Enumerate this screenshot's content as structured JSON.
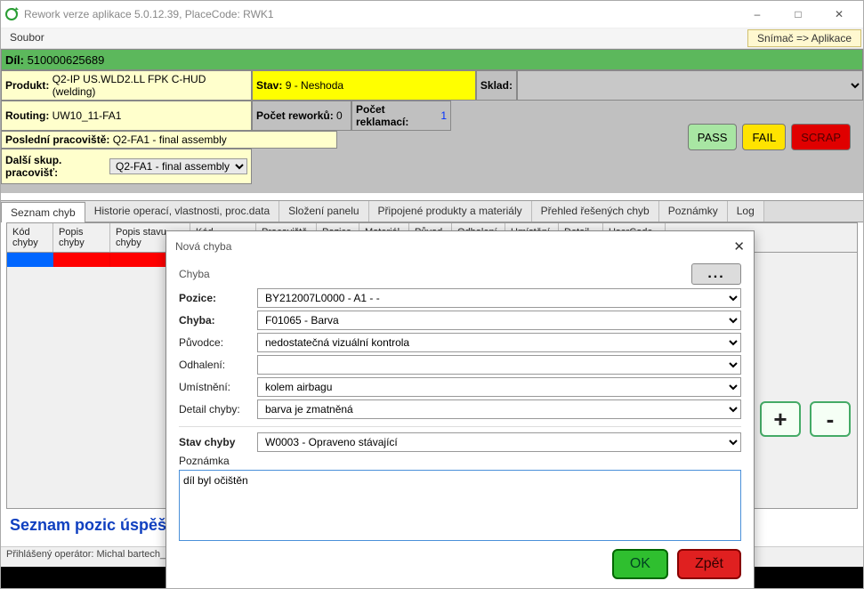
{
  "window": {
    "title": "Rework verze aplikace 5.0.12.39, PlaceCode: RWK1"
  },
  "menu": {
    "file": "Soubor",
    "right": "Snímač => Aplikace"
  },
  "dil": {
    "label": "Díl:",
    "value": "510000625689"
  },
  "info": {
    "product_label": "Produkt:",
    "product_value": "Q2-IP US.WLD2.LL FPK C-HUD (welding)",
    "stav_label": "Stav:",
    "stav_value": "9 - Neshoda",
    "sklad_label": "Sklad:",
    "sklad_value": "",
    "routing_label": "Routing:",
    "routing_value": "UW10_11-FA1",
    "reworku_label": "Počet reworků:",
    "reworku_value": "0",
    "reklamaci_label": "Počet reklamací:",
    "reklamaci_value": "1",
    "posledni_label": "Poslední pracoviště:",
    "posledni_value": "Q2-FA1 - final assembly",
    "dalsi_label": "Další skup. pracovišť:",
    "dalsi_value": "Q2-FA1 - final assembly"
  },
  "buttons": {
    "pass": "PASS",
    "fail": "FAIL",
    "scrap": "SCRAP"
  },
  "tabs": {
    "t0": "Seznam chyb",
    "t1": "Historie operací, vlastnosti, proc.data",
    "t2": "Složení panelu",
    "t3": "Připojené produkty a materiály",
    "t4": "Přehled řešených chyb",
    "t5": "Poznámky",
    "t6": "Log"
  },
  "cols": {
    "c0": "Kód chyby",
    "c1": "Popis chyby",
    "c2": "Popis stavu chyby",
    "c3": "Kód pracoviště",
    "c4": "Pracoviště",
    "c5": "Pozice",
    "c6": "Materiál",
    "c7": "Původ",
    "c8": "Odhalení",
    "c9": "Umístění",
    "c10": "Detail chyby",
    "c11": "UserCode"
  },
  "heading": "Seznam pozic úspěšně",
  "status": "Přihlášený operátor: Michal bartech_Vane",
  "modal": {
    "title": "Nová chyba",
    "section": "Chyba",
    "dots": "...",
    "pozice_l": "Pozice:",
    "pozice_v": "BY212007L0000 - A1 -  -",
    "chyba_l": "Chyba:",
    "chyba_v": "F01065 - Barva",
    "puvodce_l": "Původce:",
    "puvodce_v": "nedostatečná vizuální kontrola",
    "odhaleni_l": "Odhalení:",
    "odhaleni_v": "",
    "umisteni_l": "Umístnění:",
    "umisteni_v": "kolem airbagu",
    "detail_l": "Detail chyby:",
    "detail_v": "barva je zmatněná",
    "stav_l": "Stav chyby",
    "stav_v": "W0003 - Opraveno stávající",
    "pozn_l": "Poznámka",
    "pozn_v": "díl byl očištěn",
    "ok": "OK",
    "back": "Zpět"
  },
  "pm": {
    "plus": "+",
    "minus": "-"
  }
}
